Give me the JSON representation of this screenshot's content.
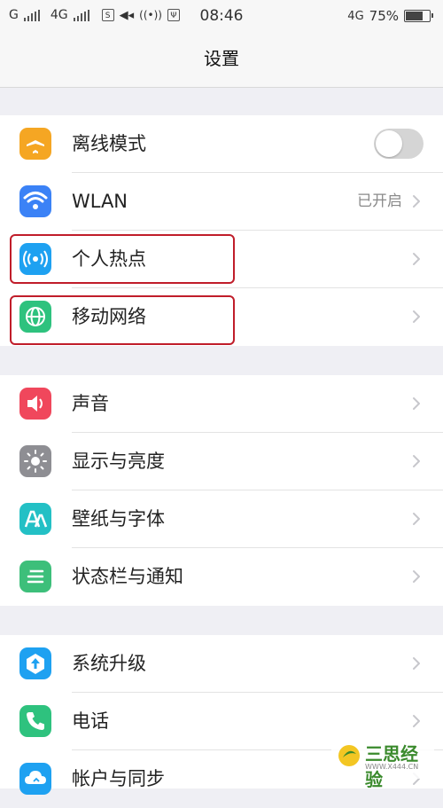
{
  "status_bar": {
    "carrier1": "G",
    "carrier2": "4G",
    "time": "08:46",
    "network": "4G",
    "battery": "75%",
    "battery_level": 0.75
  },
  "title": "设置",
  "group1": [
    {
      "label": "离线模式",
      "icon": "airplane-icon",
      "color": "#f5a623",
      "toggle": false
    },
    {
      "label": "WLAN",
      "icon": "wifi-icon",
      "color": "#3b82f6",
      "value": "已开启"
    },
    {
      "label": "个人热点",
      "icon": "hotspot-icon",
      "color": "#1ea1f1"
    },
    {
      "label": "移动网络",
      "icon": "globe-icon",
      "color": "#2ec27e"
    }
  ],
  "group2": [
    {
      "label": "声音",
      "icon": "speaker-icon",
      "color": "#f0475c"
    },
    {
      "label": "显示与亮度",
      "icon": "sun-icon",
      "color": "#8e8e93"
    },
    {
      "label": "壁纸与字体",
      "icon": "font-icon",
      "color": "#23c0c5"
    },
    {
      "label": "状态栏与通知",
      "icon": "list-icon",
      "color": "#3dbf7a"
    }
  ],
  "group3": [
    {
      "label": "系统升级",
      "icon": "update-icon",
      "color": "#1ea1f1"
    },
    {
      "label": "电话",
      "icon": "phone-icon",
      "color": "#2ec27e"
    },
    {
      "label": "帐户与同步",
      "icon": "cloud-icon",
      "color": "#1ea1f1"
    }
  ],
  "watermark": {
    "name": "三思经验",
    "site": "WWW.X444.CN"
  }
}
